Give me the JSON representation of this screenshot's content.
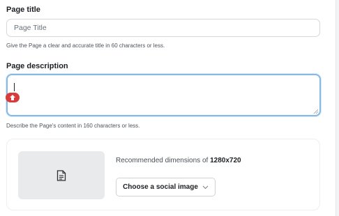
{
  "page_title": {
    "label": "Page title",
    "placeholder": "Page Title",
    "helper": "Give the Page a clear and accurate title in 60 characters or less."
  },
  "page_description": {
    "label": "Page description",
    "value": "",
    "helper": "Describe the Page's content in 160 characters or less."
  },
  "social_image": {
    "dimensions_prefix": "Recommended dimensions of ",
    "dimensions_value": "1280x720",
    "button_label": "Choose a social image",
    "icons": {
      "placeholder": "document-icon",
      "button": "chevron-down-icon"
    }
  },
  "colors": {
    "focus_border": "#86b9e3",
    "extension_badge": "#d93b3b",
    "thumb_bg": "#e8eaec"
  }
}
